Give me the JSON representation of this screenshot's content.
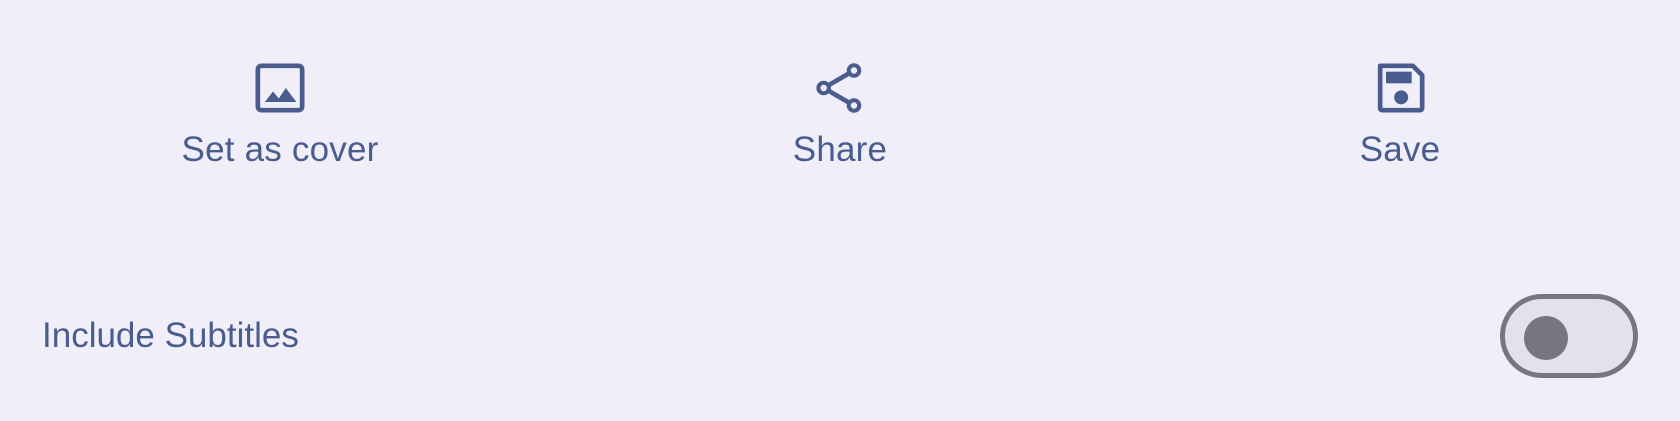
{
  "actions": [
    {
      "label": "Set as cover",
      "icon": "image-icon"
    },
    {
      "label": "Share",
      "icon": "share-icon"
    },
    {
      "label": "Save",
      "icon": "save-icon"
    }
  ],
  "subtitles": {
    "label": "Include Subtitles",
    "enabled": false
  },
  "colors": {
    "background": "#f0eff9",
    "accent": "#4a5c8e",
    "switch_outline": "#77767f",
    "switch_track": "#e3e2ea"
  }
}
